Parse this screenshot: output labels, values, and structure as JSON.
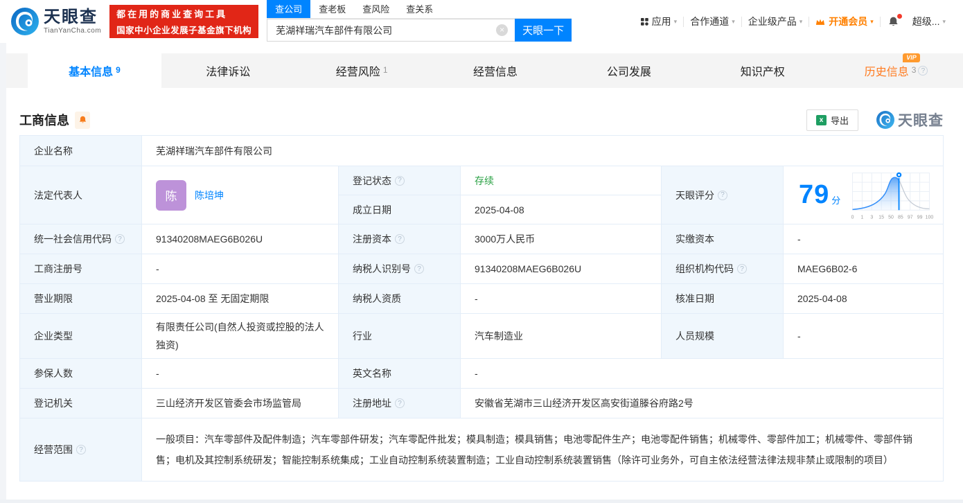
{
  "header": {
    "logo": {
      "title": "天眼查",
      "domain": "TianYanCha.com"
    },
    "banner": {
      "line1": "都在用的商业查询工具",
      "line2": "国家中小企业发展子基金旗下机构"
    },
    "search": {
      "tabs": [
        {
          "label": "查公司"
        },
        {
          "label": "查老板"
        },
        {
          "label": "查风险"
        },
        {
          "label": "查关系"
        }
      ],
      "value": "芜湖祥瑞汽车部件有限公司",
      "button": "天眼一下"
    },
    "nav": {
      "apps": "应用",
      "cooperation": "合作通道",
      "enterprise": "企业级产品",
      "vip": "开通会员",
      "user": "超级..."
    }
  },
  "tabs": {
    "vip_badge": "VIP",
    "items": [
      {
        "label": "基本信息",
        "count": "9"
      },
      {
        "label": "法律诉讼",
        "count": ""
      },
      {
        "label": "经营风险",
        "count": "1"
      },
      {
        "label": "经营信息",
        "count": ""
      },
      {
        "label": "公司发展",
        "count": ""
      },
      {
        "label": "知识产权",
        "count": ""
      },
      {
        "label": "历史信息",
        "count": "3"
      }
    ]
  },
  "section": {
    "title": "工商信息",
    "export": "导出",
    "watermark": "天眼查"
  },
  "score": {
    "label": "天眼评分",
    "value": "79",
    "unit": "分",
    "ticks": [
      "0",
      "1",
      "3",
      "15",
      "50",
      "85",
      "97",
      "99",
      "100"
    ]
  },
  "table": {
    "company_name": {
      "label": "企业名称",
      "value": "芜湖祥瑞汽车部件有限公司"
    },
    "legal_rep": {
      "label": "法定代表人",
      "avatar_char": "陈",
      "name": "陈培坤"
    },
    "reg_status": {
      "label": "登记状态",
      "value": "存续"
    },
    "establish_date": {
      "label": "成立日期",
      "value": "2025-04-08"
    },
    "credit_code": {
      "label": "统一社会信用代码",
      "value": "91340208MAEG6B026U"
    },
    "reg_capital": {
      "label": "注册资本",
      "value": "3000万人民币"
    },
    "paid_capital": {
      "label": "实缴资本",
      "value": "-"
    },
    "reg_number": {
      "label": "工商注册号",
      "value": "-"
    },
    "taxpayer_id": {
      "label": "纳税人识别号",
      "value": "91340208MAEG6B026U"
    },
    "org_code": {
      "label": "组织机构代码",
      "value": "MAEG6B02-6"
    },
    "business_term": {
      "label": "营业期限",
      "value": "2025-04-08 至 无固定期限"
    },
    "taxpayer_quality": {
      "label": "纳税人资质",
      "value": "-"
    },
    "approval_date": {
      "label": "核准日期",
      "value": "2025-04-08"
    },
    "company_type": {
      "label": "企业类型",
      "value": "有限责任公司(自然人投资或控股的法人独资)"
    },
    "industry": {
      "label": "行业",
      "value": "汽车制造业"
    },
    "staff_size": {
      "label": "人员规模",
      "value": "-"
    },
    "insured_count": {
      "label": "参保人数",
      "value": "-"
    },
    "english_name": {
      "label": "英文名称",
      "value": "-"
    },
    "reg_authority": {
      "label": "登记机关",
      "value": "三山经济开发区管委会市场监管局"
    },
    "reg_address": {
      "label": "注册地址",
      "value": "安徽省芜湖市三山经济开发区高安街道滕谷府路2号"
    },
    "business_scope": {
      "label": "经营范围",
      "value": "一般项目：汽车零部件及配件制造；汽车零部件研发；汽车零配件批发；模具制造；模具销售；电池零配件生产；电池零配件销售；机械零件、零部件加工；机械零件、零部件销售；电机及其控制系统研发；智能控制系统集成；工业自动控制系统装置制造；工业自动控制系统装置销售（除许可业务外，可自主依法经营法律法规非禁止或限制的项目）"
    }
  },
  "icons": {
    "help": "?",
    "caret": "▾",
    "clear": "×",
    "excel": "x"
  },
  "colors": {
    "brand_blue": "#0084ff",
    "banner_red": "#e12617",
    "status_green": "#2ba245",
    "history_orange": "#ff7a1e",
    "vip_orange": "#ff8000",
    "avatar_purple": "#bd92d9"
  }
}
